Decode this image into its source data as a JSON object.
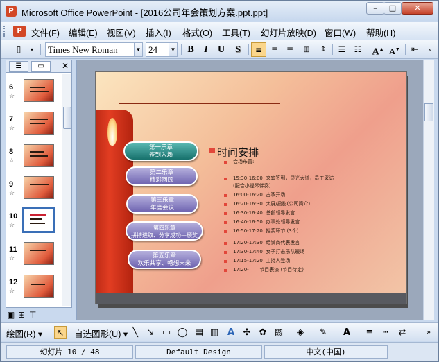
{
  "window": {
    "title": "Microsoft Office PowerPoint - [2016公司年会策划方案.ppt.ppt]",
    "min": "–",
    "max": "□",
    "close": "✕"
  },
  "menu": {
    "items": [
      "文件(F)",
      "编辑(E)",
      "视图(V)",
      "插入(I)",
      "格式(O)",
      "工具(T)",
      "幻灯片放映(D)",
      "窗口(W)",
      "帮助(H)"
    ]
  },
  "toolbar": {
    "font": "Times New Roman",
    "size": "24",
    "bold": "B",
    "italic": "I",
    "underline": "U",
    "shadow": "S"
  },
  "panel": {
    "close": "✕",
    "thumbs": [
      {
        "num": "6"
      },
      {
        "num": "7"
      },
      {
        "num": "8"
      },
      {
        "num": "9"
      },
      {
        "num": "10"
      },
      {
        "num": "11"
      },
      {
        "num": "12"
      }
    ]
  },
  "slide": {
    "pills": [
      "第一乐章\n签到入场",
      "第二乐章\n精彩回顾",
      "第三乐章\n年度会议",
      "第四乐章\n拼搏进取、分享成功—颁奖",
      "第五乐章\n欢乐共享、畅想未来"
    ],
    "heading": "时间安排",
    "schedule": [
      "会场布置:",
      "15:30-16:00  来宾签到，显光大道，员工采访\n(配合小提琴伴奏)",
      "16:00-16:20  古筝开场",
      "16:20-16:30  大屏/投影(公司简介)",
      "16:30-16:40  总部领导发言",
      "16:40-16:50  办事处领导发言",
      "16:50-17:20  抽奖环节 (3个)",
      "17:20-17:30  经销商代表发言",
      "17:30-17:40  女子打击乐队暖场",
      "17:15-17:20  主持人登场",
      "17:20-       节目表演 (节目待定)"
    ]
  },
  "drawbar": {
    "draw": "绘图(R)",
    "autoshape": "自选图形(U)"
  },
  "status": {
    "slide": "幻灯片 10 / 48",
    "design": "Default Design",
    "lang": "中文(中国)"
  }
}
